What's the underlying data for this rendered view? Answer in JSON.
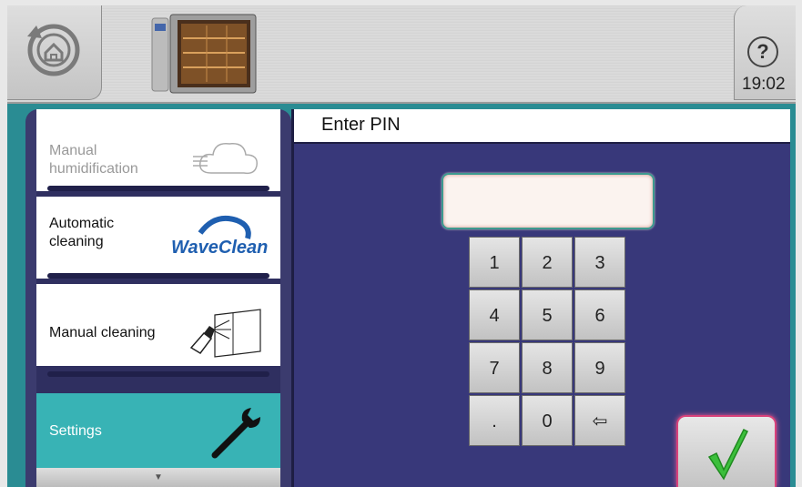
{
  "header": {
    "home_icon": "home-back-icon",
    "appliance_icon": "combi-oven-icon",
    "help_symbol": "?",
    "time": "19:02"
  },
  "menu": {
    "items": [
      {
        "label_line1": "Manual",
        "label_line2": "humidification",
        "icon": "cloud-steam-icon",
        "enabled": false
      },
      {
        "label_line1": "Automatic",
        "label_line2": "cleaning",
        "icon": "waveclean-logo",
        "logo_text": "WaveClean"
      },
      {
        "label_line1": "Manual cleaning",
        "label_line2": "",
        "icon": "manual-spray-icon"
      },
      {
        "label_line1": "Settings",
        "label_line2": "",
        "icon": "wrench-icon",
        "selected": true
      }
    ],
    "scroll_indicator": "▼"
  },
  "pin_dialog": {
    "title": "Enter PIN",
    "pin_value": "",
    "keys": [
      "1",
      "2",
      "3",
      "4",
      "5",
      "6",
      "7",
      "8",
      "9",
      ".",
      "0",
      "⇦"
    ],
    "confirm_icon": "checkmark-icon"
  },
  "colors": {
    "accent_teal": "#38b3b5",
    "panel_blue": "#38387a",
    "confirm_green": "#3cbf3c",
    "confirm_border": "#d9427b"
  }
}
